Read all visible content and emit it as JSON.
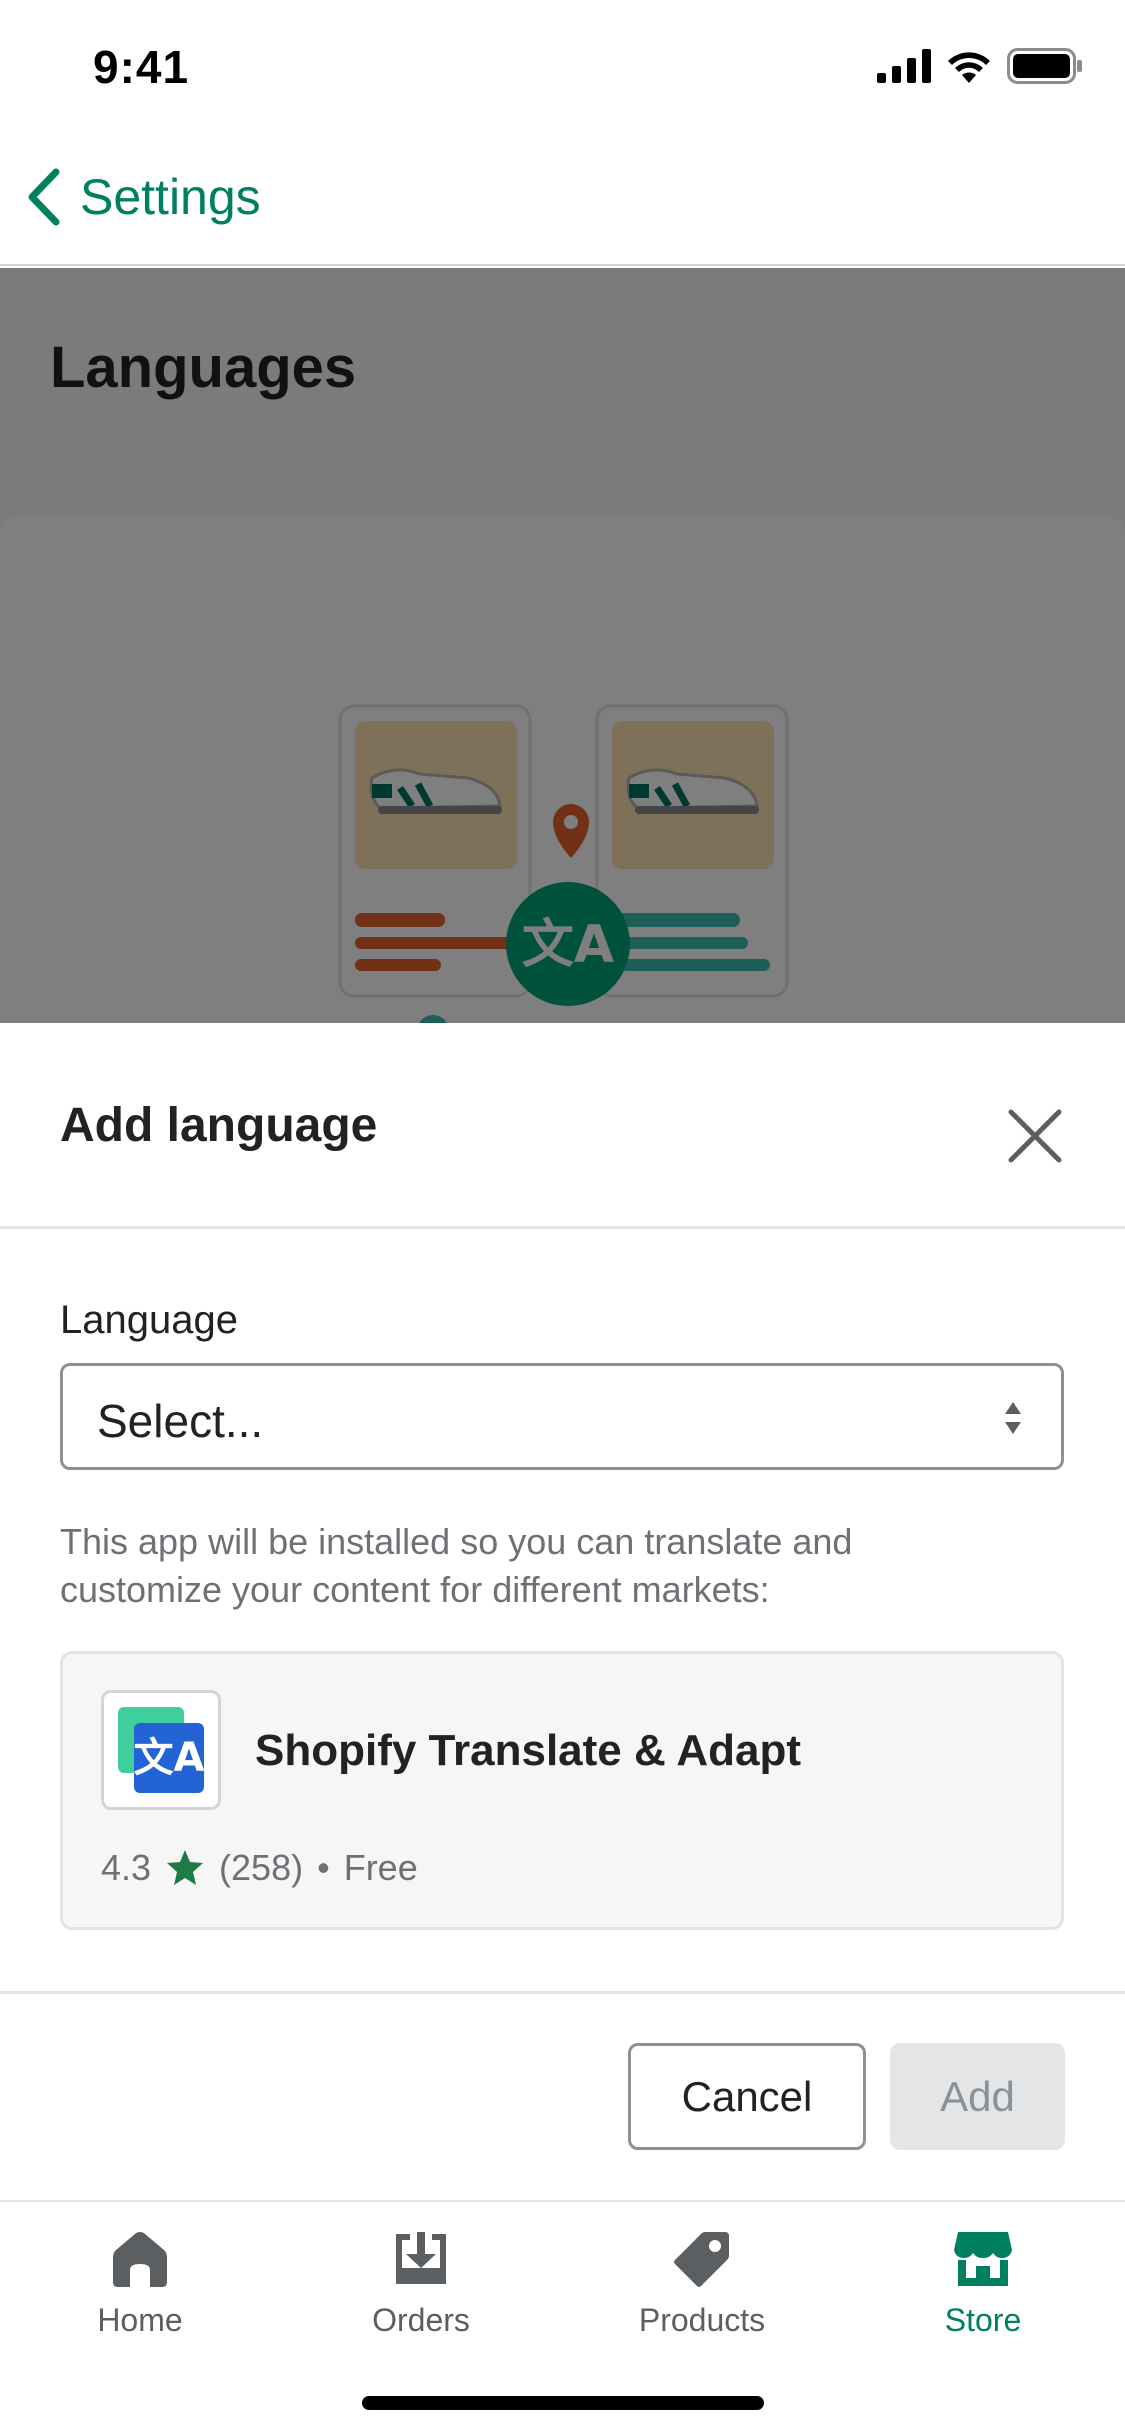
{
  "status_bar": {
    "time": "9:41"
  },
  "nav": {
    "back_label": "Settings"
  },
  "background_page": {
    "title": "Languages"
  },
  "modal": {
    "title": "Add language",
    "language_field": {
      "label": "Language",
      "value": "Select..."
    },
    "help_text": "This app will be installed so you can translate and customize your content for different markets:",
    "app": {
      "name": "Shopify Translate & Adapt",
      "rating": "4.3",
      "reviews": "(258)",
      "separator": "•",
      "price": "Free"
    },
    "cancel_label": "Cancel",
    "add_label": "Add"
  },
  "tabs": [
    {
      "label": "Home",
      "icon": "home-icon",
      "active": false
    },
    {
      "label": "Orders",
      "icon": "orders-icon",
      "active": false
    },
    {
      "label": "Products",
      "icon": "products-tag-icon",
      "active": false
    },
    {
      "label": "Store",
      "icon": "store-icon",
      "active": true
    }
  ],
  "colors": {
    "accent": "#008060",
    "text": "#202223",
    "subdued_text": "#6d7175",
    "star": "#1f7a45",
    "disabled_bg": "#e4e5e7"
  }
}
